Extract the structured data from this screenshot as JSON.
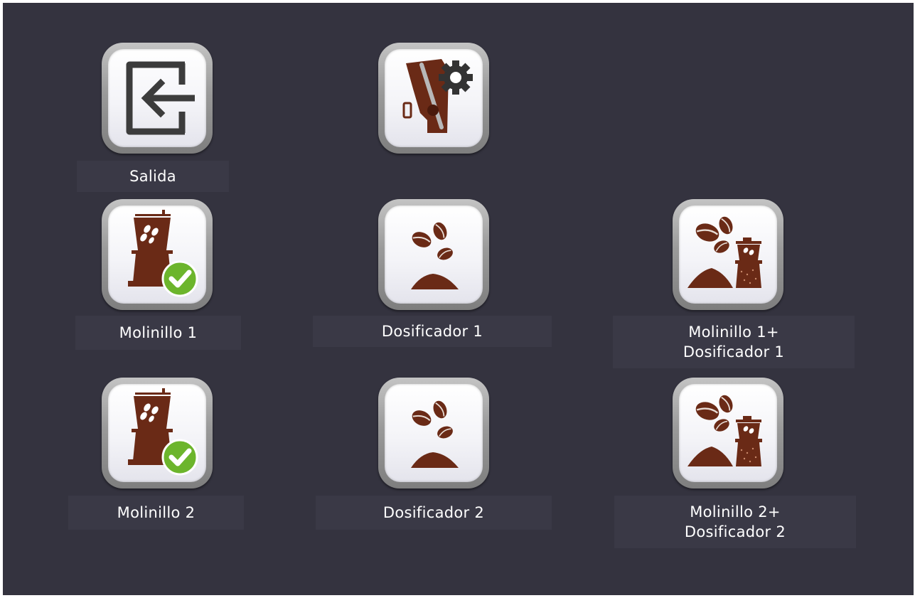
{
  "colors": {
    "background": "#34333f",
    "label_bg": "#3a3946",
    "coffee_brown": "#6a2a16",
    "check_green": "#6cb52c"
  },
  "buttons": [
    {
      "id": "salida",
      "label": "Salida",
      "icon": "exit-icon"
    },
    {
      "id": "grinder-settings",
      "label": "",
      "icon": "grinder-settings-icon"
    },
    {
      "id": "molinillo-1",
      "label": "Molinillo 1",
      "icon": "grinder-check-icon"
    },
    {
      "id": "dosificador-1",
      "label": "Dosificador 1",
      "icon": "coffee-beans-dose-icon"
    },
    {
      "id": "molinillo-dosificador-1",
      "label": "Molinillo 1+\nDosificador 1",
      "icon": "beans-grinder-icon"
    },
    {
      "id": "molinillo-2",
      "label": "Molinillo 2",
      "icon": "grinder-check-icon"
    },
    {
      "id": "dosificador-2",
      "label": "Dosificador 2",
      "icon": "coffee-beans-dose-icon"
    },
    {
      "id": "molinillo-dosificador-2",
      "label": "Molinillo 2+\nDosificador 2",
      "icon": "beans-grinder-icon"
    }
  ]
}
